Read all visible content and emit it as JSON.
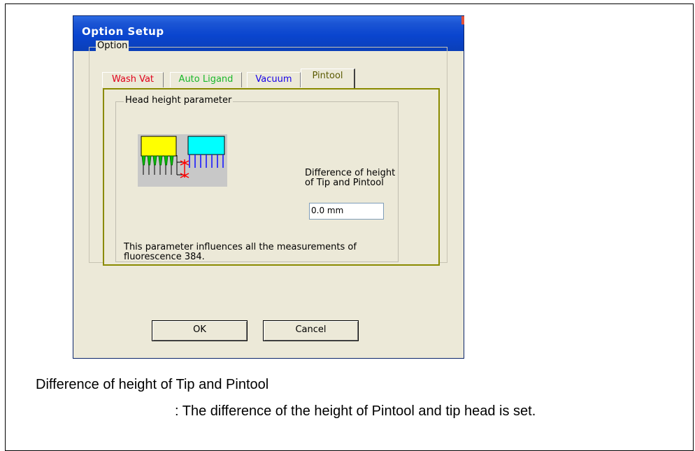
{
  "dialog": {
    "title": "Option Setup",
    "option_group_label": "Option",
    "tabs": [
      {
        "label": "Wash Vat",
        "color": "#e0001b"
      },
      {
        "label": "Auto Ligand",
        "color": "#18b82a"
      },
      {
        "label": "Vacuum",
        "color": "#1500e8"
      },
      {
        "label": "Pintool",
        "color": "#5a5a00",
        "active": true
      }
    ],
    "head_group_label": "Head height parameter",
    "diff_label_line1": "Difference of height",
    "diff_label_line2": "of Tip and Pintool",
    "height_value": "0.0 mm",
    "info_line1": "This parameter influences all the measurements of",
    "info_line2": "fluorescence 384.",
    "ok_label": "OK",
    "cancel_label": "Cancel"
  },
  "caption": {
    "term": "Difference of height of Tip and Pintool",
    "description": ": The difference of the height of Pintool and tip head is set."
  },
  "colors": {
    "titlebar": "#0a45cf",
    "tip_head": "#ffff00",
    "pintool_head": "#00ffff",
    "tips": "#00c000",
    "pins": "#1a1aff",
    "marker": "#ff0000"
  },
  "icons": [
    "head-height-illustration"
  ]
}
